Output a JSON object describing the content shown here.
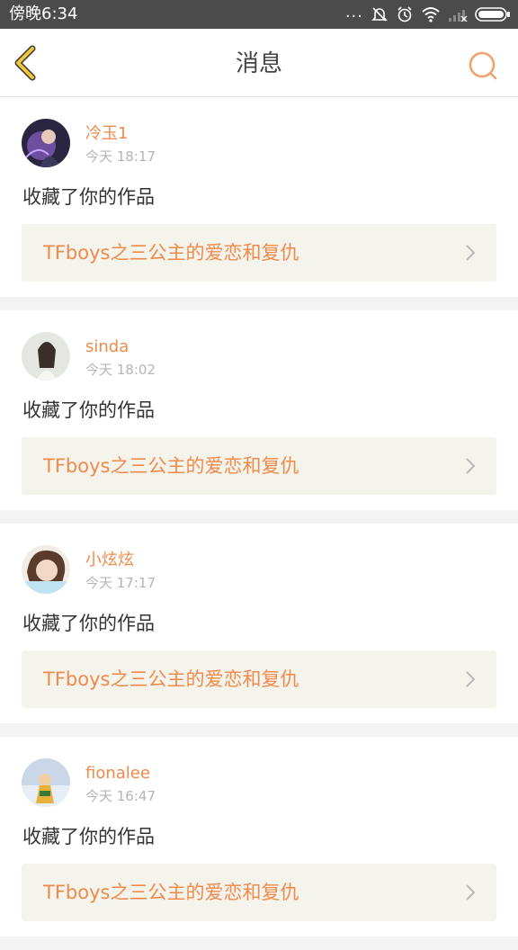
{
  "statusbar": {
    "time": "傍晚6:34",
    "dots": "..."
  },
  "header": {
    "title": "消息"
  },
  "colors": {
    "accent": "#f08a4b",
    "back_arrow": "#f1c63b",
    "link_bg": "#f4f3ec"
  },
  "icons": {
    "back": "chevron-left-icon",
    "search": "search-icon",
    "mute": "mute-icon",
    "alarm": "alarm-icon",
    "wifi": "wifi-icon",
    "signal": "signal-icon",
    "battery": "battery-icon",
    "link_arrow": "chevron-right-icon"
  },
  "messages": [
    {
      "user": "冷玉1",
      "time": "今天 18:17",
      "action": "收藏了你的作品",
      "work": "TFboys之三公主的爱恋和复仇"
    },
    {
      "user": "sinda",
      "time": "今天 18:02",
      "action": "收藏了你的作品",
      "work": "TFboys之三公主的爱恋和复仇"
    },
    {
      "user": "小炫炫",
      "time": "今天 17:17",
      "action": "收藏了你的作品",
      "work": "TFboys之三公主的爱恋和复仇"
    },
    {
      "user": "fionalee",
      "time": "今天 16:47",
      "action": "收藏了你的作品",
      "work": "TFboys之三公主的爱恋和复仇"
    }
  ]
}
